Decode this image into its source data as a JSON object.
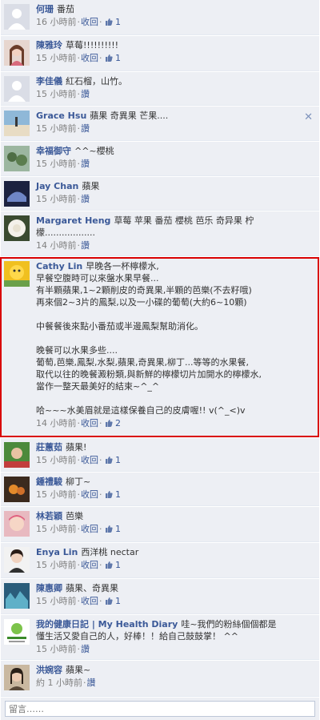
{
  "comments": [
    {
      "author": "何珊",
      "text": "番茄",
      "time": "16 小時前",
      "action": "收回",
      "likes": "1"
    },
    {
      "author": "陳雅玲",
      "text": "草莓!!!!!!!!!!",
      "time": "15 小時前",
      "action": "收回",
      "likes": "1"
    },
    {
      "author": "李佳儀",
      "text": "紅石榴，山竹。",
      "time": "15 小時前",
      "action": "讚"
    },
    {
      "author": "Grace Hsu",
      "text": "蘋果 奇異果 芒果....",
      "time": "15 小時前",
      "action": "讚"
    },
    {
      "author": "幸福御守",
      "text": "^^~櫻桃",
      "time": "15 小時前",
      "action": "讚"
    },
    {
      "author": "Jay Chan",
      "text": "蘋果",
      "time": "15 小時前",
      "action": "讚"
    },
    {
      "author": "Margaret Heng",
      "text": "草莓 苹果 番茄 櫻桃 芭乐 奇异果 柠\n檬..................",
      "time": "14 小時前",
      "action": "讚"
    },
    {
      "author": "Cathy Lin",
      "text": "早晚各一杯檸檬水,\n早餐空腹時可以來盤水果早餐...\n有半顆蘋果,1~2顆削皮的奇異果,半顆的芭樂(不去籽哦)\n再來個2~3片的鳳梨,以及一小碟的葡萄(大約6~10顆)\n\n中餐餐後來點小番茄或半邊鳳梨幫助消化。\n\n晚餐可以水果多些....\n葡萄,芭樂,鳳梨,水梨,蘋果,奇異果,柳丁...等等的水果餐,\n取代以往的晚餐澱粉類,與新鮮的檸檬切片加開水的檸檬水,\n當作一整天最美好的結束~^_^\n\n哈~~~水美眉就是這樣保養自己的皮膚喔!! v(^_<)v",
      "time": "14 小時前",
      "action": "收回",
      "likes": "2"
    },
    {
      "author": "莊蕙茹",
      "text": "蘋果!",
      "time": "15 小時前",
      "action": "收回",
      "likes": "1"
    },
    {
      "author": "鍾禮駿",
      "text": "柳丁~",
      "time": "15 小時前",
      "action": "收回",
      "likes": "1"
    },
    {
      "author": "林若穎",
      "text": "芭樂",
      "time": "15 小時前",
      "action": "收回",
      "likes": "1"
    },
    {
      "author": "Enya Lin",
      "text": "西洋桃 nectar",
      "time": "15 小時前",
      "action": "收回",
      "likes": "1"
    },
    {
      "author": "陳惠卿",
      "text": "蘋果、奇異果",
      "time": "15 小時前",
      "action": "收回",
      "likes": "1"
    },
    {
      "author": "我的健康日記 | My Health Diary",
      "text": "哇~我們的粉絲個個都是\n懂生活又愛自己的人，好棒！！給自己鼓鼓掌！ ^^",
      "time": "15 小時前",
      "action": "讚"
    },
    {
      "author": "洪婉容",
      "text": "蘋果~",
      "time": "約 1 小時前",
      "action": "讚"
    }
  ],
  "reply": {
    "placeholder": "留言……"
  },
  "colors": {
    "link": "#3b5998",
    "bg": "#edeff4",
    "highlight": "#d90000"
  },
  "icons": {
    "like": "thumbs-up-icon",
    "close": "close-icon"
  }
}
